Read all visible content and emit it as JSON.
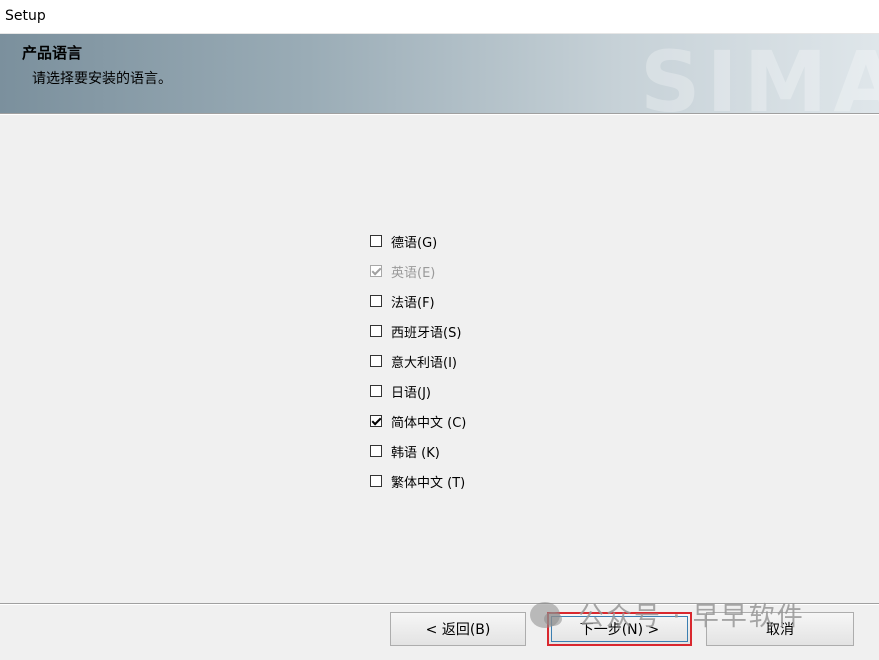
{
  "window": {
    "title": "Setup"
  },
  "banner": {
    "title": "产品语言",
    "subtitle": "请选择要安装的语言。",
    "watermark": "SIMA"
  },
  "languages": [
    {
      "label": "德语(G)",
      "checked": false,
      "disabled": false
    },
    {
      "label": "英语(E)",
      "checked": true,
      "disabled": true
    },
    {
      "label": "法语(F)",
      "checked": false,
      "disabled": false
    },
    {
      "label": "西班牙语(S)",
      "checked": false,
      "disabled": false
    },
    {
      "label": "意大利语(I)",
      "checked": false,
      "disabled": false
    },
    {
      "label": "日语(J)",
      "checked": false,
      "disabled": false
    },
    {
      "label": "简体中文 (C)",
      "checked": true,
      "disabled": false
    },
    {
      "label": "韩语 (K)",
      "checked": false,
      "disabled": false
    },
    {
      "label": "繁体中文 (T)",
      "checked": false,
      "disabled": false
    }
  ],
  "buttons": {
    "back": "< 返回(B)",
    "next": "下一步(N) >",
    "cancel": "取消"
  },
  "overlay_watermark": "公众号 · 早早软件"
}
